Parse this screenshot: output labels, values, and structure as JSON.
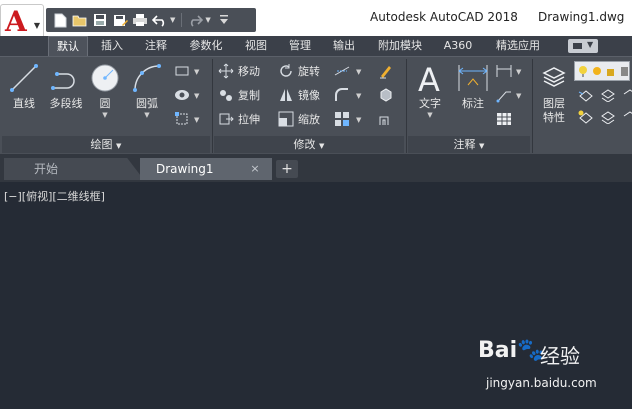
{
  "title_bar": {
    "app_logo_letter": "A",
    "app_title": "Autodesk AutoCAD 2018",
    "document_title": "Drawing1.dwg",
    "quick_access_icons": [
      "new-icon",
      "open-icon",
      "save-icon",
      "save-as-icon",
      "print-icon",
      "undo-icon",
      "redo-icon",
      "customize-icon"
    ]
  },
  "ribbon_tabs": [
    {
      "label": "默认",
      "active": true
    },
    {
      "label": "插入"
    },
    {
      "label": "注释"
    },
    {
      "label": "参数化"
    },
    {
      "label": "视图"
    },
    {
      "label": "管理"
    },
    {
      "label": "输出"
    },
    {
      "label": "附加模块"
    },
    {
      "label": "A360"
    },
    {
      "label": "精选应用"
    }
  ],
  "panels": {
    "draw": {
      "title": "绘图",
      "line": "直线",
      "polyline": "多段线",
      "circle": "圆",
      "arc": "圆弧"
    },
    "modify": {
      "title": "修改",
      "move": "移动",
      "rotate": "旋转",
      "copy": "复制",
      "mirror": "镜像",
      "stretch": "拉伸",
      "scale": "缩放"
    },
    "annotation": {
      "title": "注释",
      "text": "文字",
      "dimension": "标注"
    },
    "layers": {
      "properties_line1": "图层",
      "properties_line2": "特性"
    }
  },
  "document_tabs": {
    "start": "开始",
    "drawing": "Drawing1",
    "close": "×",
    "add": "+"
  },
  "viewport_label": "[−][俯视][二维线框]",
  "watermark": {
    "logo": "Bai🐾",
    "text": "经验",
    "url": "jingyan.baidu.com"
  },
  "colors": {
    "ribbon_bg": "#4a4f57",
    "canvas_bg": "#252b35",
    "logo_red": "#cc1a1f"
  }
}
